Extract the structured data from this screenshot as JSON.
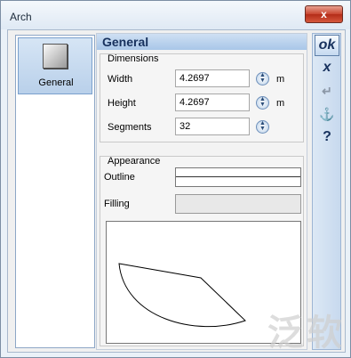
{
  "window": {
    "title": "Arch",
    "close_glyph": "x"
  },
  "sidebar": {
    "items": [
      {
        "label": "General",
        "icon": "square-gradient-icon",
        "selected": true
      }
    ]
  },
  "panel": {
    "title": "General"
  },
  "dimensions": {
    "title": "Dimensions",
    "fields": [
      {
        "label": "Width",
        "value": "4.2697",
        "unit": "m"
      },
      {
        "label": "Height",
        "value": "4.2697",
        "unit": "m"
      },
      {
        "label": "Segments",
        "value": "32",
        "unit": ""
      }
    ]
  },
  "appearance": {
    "title": "Appearance",
    "outline_label": "Outline",
    "filling_label": "Filling"
  },
  "toolbar": {
    "ok_label": "ok",
    "cancel_glyph": "x",
    "apply_glyph": "↵",
    "pin_glyph": "⚓",
    "help_glyph": "?"
  },
  "watermark": {
    "text": "泛软"
  }
}
